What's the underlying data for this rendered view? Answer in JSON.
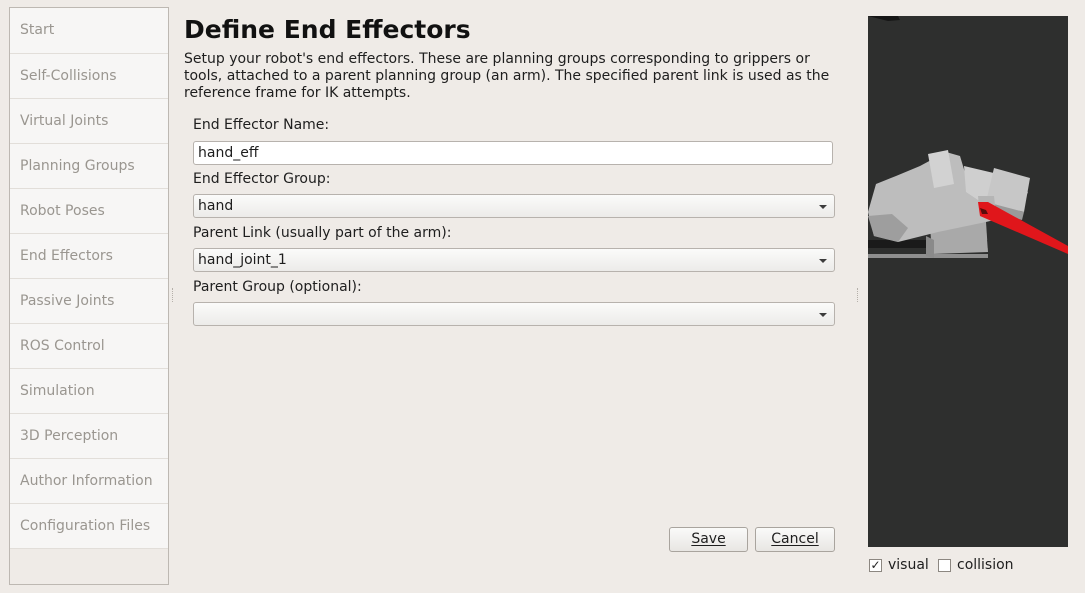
{
  "sidebar": {
    "items": [
      {
        "label": "Start"
      },
      {
        "label": "Self-Collisions"
      },
      {
        "label": "Virtual Joints"
      },
      {
        "label": "Planning Groups"
      },
      {
        "label": "Robot Poses"
      },
      {
        "label": "End Effectors"
      },
      {
        "label": "Passive Joints"
      },
      {
        "label": "ROS Control"
      },
      {
        "label": "Simulation"
      },
      {
        "label": "3D Perception"
      },
      {
        "label": "Author Information"
      },
      {
        "label": "Configuration Files"
      }
    ]
  },
  "main": {
    "title": "Define End Effectors",
    "description": "Setup your robot's end effectors. These are planning groups corresponding to grippers or tools, attached to a parent planning group (an arm). The specified parent link is used as the reference frame for IK attempts.",
    "form": {
      "name_label": "End Effector Name:",
      "name_value": "hand_eff",
      "group_label": "End Effector Group:",
      "group_value": "hand",
      "parent_link_label": "Parent Link (usually part of the arm):",
      "parent_link_value": "hand_joint_1",
      "parent_group_label": "Parent Group (optional):",
      "parent_group_value": ""
    },
    "buttons": {
      "save": "Save",
      "cancel": "Cancel"
    }
  },
  "viewer": {
    "visual_label": "visual",
    "visual_checked": true,
    "collision_label": "collision",
    "collision_checked": false,
    "background_color": "#2e2f2e",
    "highlight_color": "#e0161b"
  }
}
